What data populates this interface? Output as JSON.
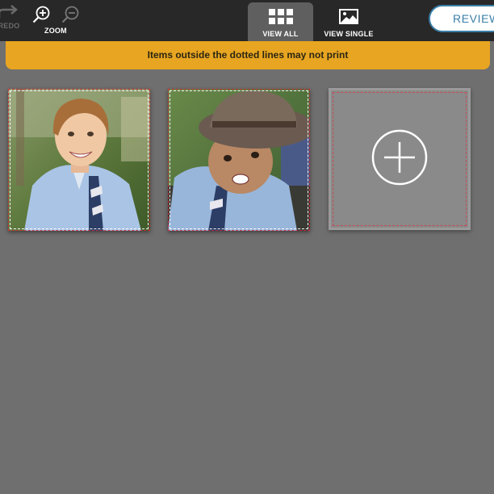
{
  "toolbar": {
    "redo_label": "REDO",
    "zoom_label": "ZOOM",
    "view_all_label": "VIEW ALL",
    "view_single_label": "VIEW SINGLE",
    "review_label": "REVIEW"
  },
  "warning": {
    "text": "Items outside the dotted lines may not print"
  },
  "tiles": [
    {
      "icon": "photo-boy-blond"
    },
    {
      "icon": "photo-boy-hat"
    },
    {
      "icon": "add-icon"
    }
  ],
  "colors": {
    "toolbar_bg": "#282828",
    "active_tab_bg": "#5f5f5f",
    "canvas_bg": "#6f6f6f",
    "warning_bg": "#e8a521",
    "accent": "#3b7fa8",
    "bleed_line": "#d62839"
  }
}
